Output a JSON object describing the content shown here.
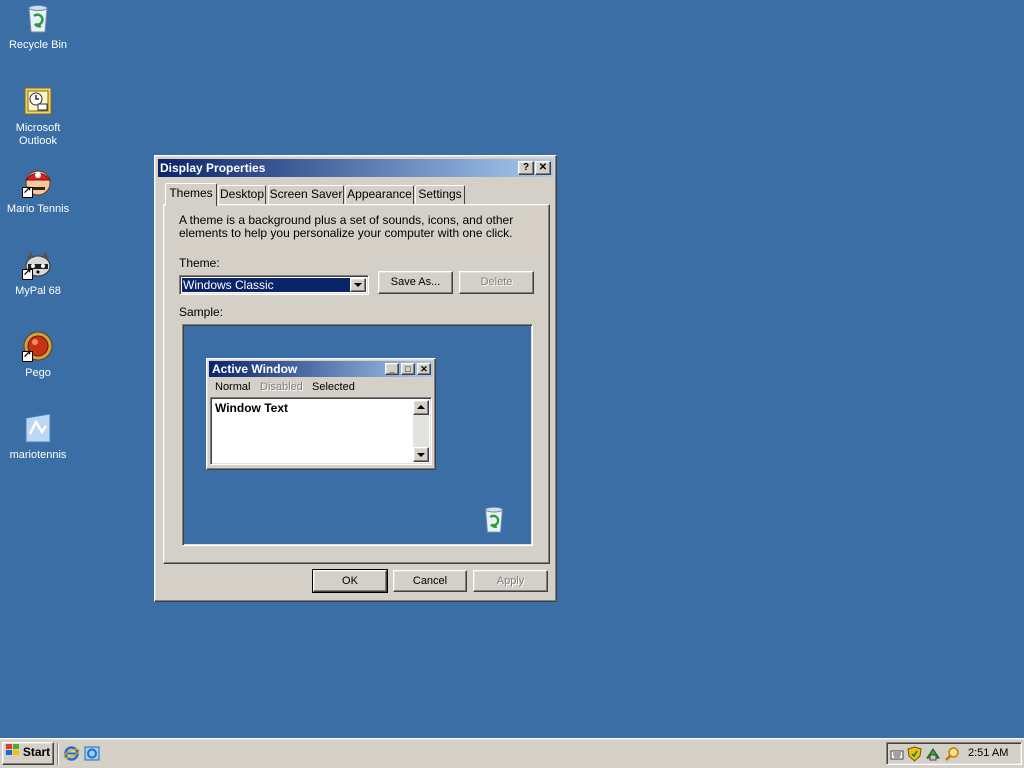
{
  "desktop": {
    "icons": [
      {
        "label": "Recycle Bin"
      },
      {
        "label": "Microsoft Outlook"
      },
      {
        "label": "Mario Tennis"
      },
      {
        "label": "MyPal 68"
      },
      {
        "label": "Pego"
      },
      {
        "label": "mariotennis"
      }
    ]
  },
  "dialog": {
    "title": "Display Properties",
    "help_label": "?",
    "close_label": "✕",
    "tabs": [
      {
        "label": "Themes"
      },
      {
        "label": "Desktop"
      },
      {
        "label": "Screen Saver"
      },
      {
        "label": "Appearance"
      },
      {
        "label": "Settings"
      }
    ],
    "description": "A theme is a background plus a set of sounds, icons, and other elements to help you personalize your computer with one click.",
    "theme_label": "Theme:",
    "theme_value": "Windows Classic",
    "save_as_label": "Save As...",
    "delete_label": "Delete",
    "sample_label": "Sample:",
    "ok_label": "OK",
    "cancel_label": "Cancel",
    "apply_label": "Apply"
  },
  "sample": {
    "window_title": "Active Window",
    "menu": [
      {
        "label": "Normal"
      },
      {
        "label": "Disabled"
      },
      {
        "label": "Selected"
      }
    ],
    "window_text": "Window Text"
  },
  "taskbar": {
    "start_label": "Start",
    "clock": "2:51 AM"
  },
  "colors": {
    "desktop": "#3a6ea5",
    "face": "#d4d0c8",
    "title_active_start": "#0a246a",
    "title_active_end": "#a6caf0",
    "selection": "#0a246a"
  }
}
